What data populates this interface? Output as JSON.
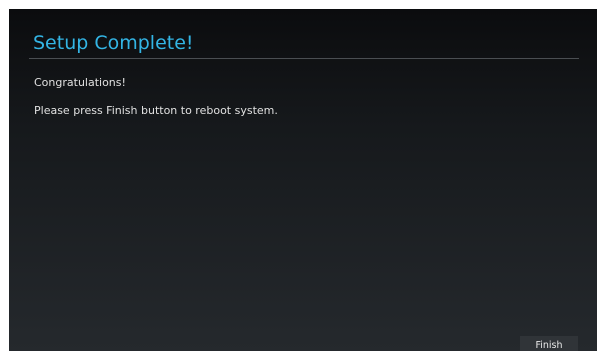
{
  "dialog": {
    "title": "Setup Complete!",
    "messages": [
      "Congratulations!",
      "Please press Finish button to reboot system."
    ],
    "finish_label": "Finish"
  },
  "colors": {
    "title": "#33b5e5",
    "background_top": "#0b0c0e",
    "background_bottom": "#25292d",
    "text": "#e0e0e0"
  }
}
